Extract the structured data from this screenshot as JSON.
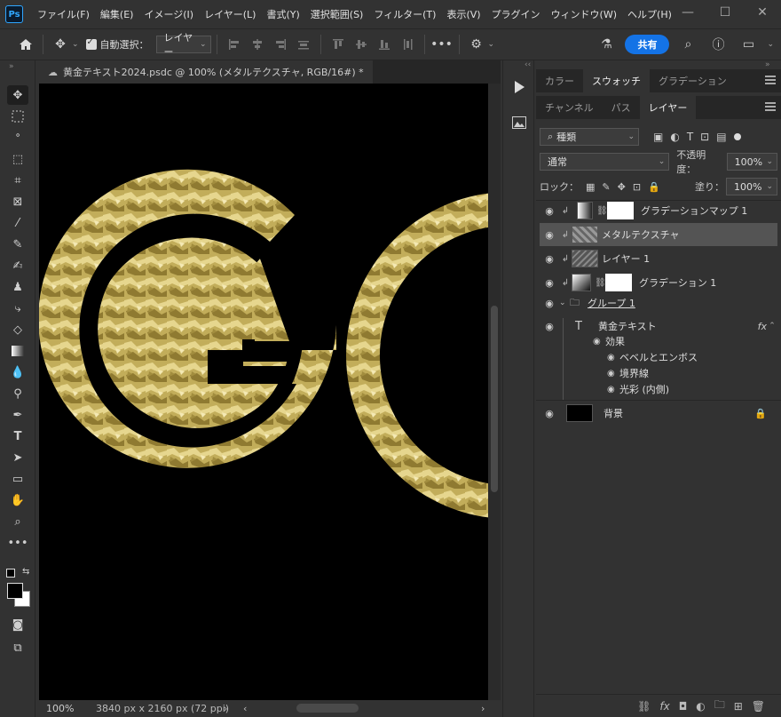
{
  "app": {
    "logo": "Ps"
  },
  "menu": [
    "ファイル(F)",
    "編集(E)",
    "イメージ(I)",
    "レイヤー(L)",
    "書式(Y)",
    "選択範囲(S)",
    "フィルター(T)",
    "表示(V)",
    "プラグイン",
    "ウィンドウ(W)",
    "ヘルプ(H)"
  ],
  "window_controls": {
    "minimize": "—",
    "maximize": "☐",
    "close": "✕"
  },
  "options": {
    "auto_select_label": "自動選択：",
    "auto_select_target": "レイヤー",
    "share_label": "共有"
  },
  "document": {
    "tab_title": "黄金テキスト2024.psdc @ 100% (メタルテクスチャ, RGB/16#) *",
    "zoom": "100%",
    "size_info": "3840 px x 2160 px (72 ppi)"
  },
  "panel_top": {
    "tabs": [
      "カラー",
      "スウォッチ",
      "グラデーション"
    ],
    "active": 1
  },
  "panel_layers": {
    "tabs": [
      "チャンネル",
      "パス",
      "レイヤー"
    ],
    "active": 2,
    "filter_kind": "種類",
    "blend_mode": "通常",
    "opacity_label": "不透明度：",
    "opacity_value": "100%",
    "lock_label": "ロック：",
    "fill_label": "塗り：",
    "fill_value": "100%",
    "layers": [
      {
        "name": "グラデーションマップ 1",
        "kind": "adjustment"
      },
      {
        "name": "メタルテクスチャ",
        "kind": "smart",
        "selected": true
      },
      {
        "name": "レイヤー 1",
        "kind": "pixel"
      },
      {
        "name": "グラデーション 1",
        "kind": "fill"
      },
      {
        "name": "グループ 1",
        "kind": "group"
      },
      {
        "name": "黄金テキスト",
        "kind": "text",
        "fx": "fx"
      },
      {
        "name": "効果",
        "kind": "effects"
      },
      {
        "name": "ベベルとエンボス",
        "kind": "effect"
      },
      {
        "name": "境界線",
        "kind": "effect"
      },
      {
        "name": "光彩 (内側)",
        "kind": "effect"
      },
      {
        "name": "背景",
        "kind": "background"
      }
    ]
  },
  "canvas_text": "GO",
  "colors": {
    "accent": "#1473e6",
    "gold": "#c9b35a",
    "bg": "#323232"
  }
}
